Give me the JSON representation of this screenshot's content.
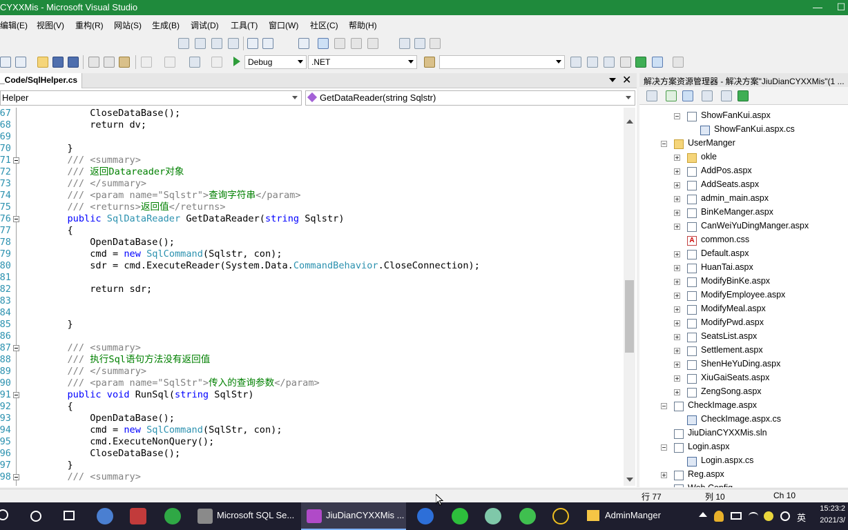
{
  "window": {
    "title": "CYXXMis - Microsoft Visual Studio",
    "minimize": "—",
    "maximize": "☐"
  },
  "menu": [
    "编辑(E)",
    "视图(V)",
    "重构(R)",
    "网站(S)",
    "生成(B)",
    "调试(D)",
    "工具(T)",
    "窗口(W)",
    "社区(C)",
    "帮助(H)"
  ],
  "toolbar": {
    "config": "Debug",
    "platform": ".NET"
  },
  "editor": {
    "tab": "_Code/SqlHelper.cs",
    "class_combo": "Helper",
    "member_combo": "GetDataReader(string Sqlstr)",
    "lines": [
      {
        "n": "67",
        "text": "            CloseDataBase();",
        "kind": "plain"
      },
      {
        "n": "68",
        "text": "            return dv;",
        "kind": "plain"
      },
      {
        "n": "69",
        "text": "",
        "kind": "plain"
      },
      {
        "n": "70",
        "text": "        }",
        "kind": "plain"
      },
      {
        "n": "71",
        "text": "        /// <summary>",
        "kind": "doc",
        "fold": true
      },
      {
        "n": "72",
        "text": "        /// 返回Datareader对象",
        "kind": "doc"
      },
      {
        "n": "73",
        "text": "        /// </summary>",
        "kind": "doc"
      },
      {
        "n": "74",
        "text": "        /// <param name=\"Sqlstr\">查询字符串</param>",
        "kind": "doc"
      },
      {
        "n": "75",
        "text": "        /// <returns>返回值</returns>",
        "kind": "doc"
      },
      {
        "n": "76",
        "text": "        public SqlDataReader GetDataReader(string Sqlstr)",
        "kind": "code",
        "fold": true
      },
      {
        "n": "77",
        "text": "        {",
        "kind": "plain"
      },
      {
        "n": "78",
        "text": "            OpenDataBase();",
        "kind": "plain"
      },
      {
        "n": "79",
        "text": "            cmd = new SqlCommand(Sqlstr, con);",
        "kind": "code"
      },
      {
        "n": "80",
        "text": "            sdr = cmd.ExecuteReader(System.Data.CommandBehavior.CloseConnection);",
        "kind": "code"
      },
      {
        "n": "81",
        "text": "",
        "kind": "plain"
      },
      {
        "n": "82",
        "text": "            return sdr;",
        "kind": "plain"
      },
      {
        "n": "83",
        "text": "",
        "kind": "plain"
      },
      {
        "n": "84",
        "text": "",
        "kind": "plain"
      },
      {
        "n": "85",
        "text": "        }",
        "kind": "plain"
      },
      {
        "n": "86",
        "text": "",
        "kind": "plain"
      },
      {
        "n": "87",
        "text": "        /// <summary>",
        "kind": "doc",
        "fold": true
      },
      {
        "n": "88",
        "text": "        /// 执行Sql语句方法没有返回值",
        "kind": "doc"
      },
      {
        "n": "89",
        "text": "        /// </summary>",
        "kind": "doc"
      },
      {
        "n": "90",
        "text": "        /// <param name=\"SqlStr\">传入的查询参数</param>",
        "kind": "doc"
      },
      {
        "n": "91",
        "text": "        public void RunSql(string SqlStr)",
        "kind": "code",
        "fold": true
      },
      {
        "n": "92",
        "text": "        {",
        "kind": "plain"
      },
      {
        "n": "93",
        "text": "            OpenDataBase();",
        "kind": "plain"
      },
      {
        "n": "94",
        "text": "            cmd = new SqlCommand(SqlStr, con);",
        "kind": "code"
      },
      {
        "n": "95",
        "text": "            cmd.ExecuteNonQuery();",
        "kind": "plain"
      },
      {
        "n": "96",
        "text": "            CloseDataBase();",
        "kind": "plain"
      },
      {
        "n": "97",
        "text": "        }",
        "kind": "plain"
      },
      {
        "n": "98",
        "text": "        /// <summary>",
        "kind": "doc",
        "fold": true
      }
    ]
  },
  "solution_explorer": {
    "title": "解决方案资源管理器 - 解决方案\"JiuDianCYXXMis\"(1 ...",
    "items": [
      {
        "label": "ShowFanKui.aspx",
        "indent": 1,
        "icon": "page",
        "exp": "minus"
      },
      {
        "label": "ShowFanKui.aspx.cs",
        "indent": 2,
        "icon": "cs",
        "exp": ""
      },
      {
        "label": "UserManger",
        "indent": 0,
        "icon": "folder",
        "exp": "minus"
      },
      {
        "label": "okle",
        "indent": 1,
        "icon": "folder",
        "exp": "plus"
      },
      {
        "label": "AddPos.aspx",
        "indent": 1,
        "icon": "page",
        "exp": "plus"
      },
      {
        "label": "AddSeats.aspx",
        "indent": 1,
        "icon": "page",
        "exp": "plus"
      },
      {
        "label": "admin_main.aspx",
        "indent": 1,
        "icon": "page",
        "exp": "plus"
      },
      {
        "label": "BinKeManger.aspx",
        "indent": 1,
        "icon": "page",
        "exp": "plus"
      },
      {
        "label": "CanWeiYuDingManger.aspx",
        "indent": 1,
        "icon": "page",
        "exp": "plus"
      },
      {
        "label": "common.css",
        "indent": 1,
        "icon": "css",
        "exp": ""
      },
      {
        "label": "Default.aspx",
        "indent": 1,
        "icon": "page",
        "exp": "plus"
      },
      {
        "label": "HuanTai.aspx",
        "indent": 1,
        "icon": "page",
        "exp": "plus"
      },
      {
        "label": "ModifyBinKe.aspx",
        "indent": 1,
        "icon": "page",
        "exp": "plus"
      },
      {
        "label": "ModifyEmployee.aspx",
        "indent": 1,
        "icon": "page",
        "exp": "plus"
      },
      {
        "label": "ModifyMeal.aspx",
        "indent": 1,
        "icon": "page",
        "exp": "plus"
      },
      {
        "label": "ModifyPwd.aspx",
        "indent": 1,
        "icon": "page",
        "exp": "plus"
      },
      {
        "label": "SeatsList.aspx",
        "indent": 1,
        "icon": "page",
        "exp": "plus"
      },
      {
        "label": "Settlement.aspx",
        "indent": 1,
        "icon": "page",
        "exp": "plus"
      },
      {
        "label": "ShenHeYuDing.aspx",
        "indent": 1,
        "icon": "page",
        "exp": "plus"
      },
      {
        "label": "XiuGaiSeats.aspx",
        "indent": 1,
        "icon": "page",
        "exp": "plus"
      },
      {
        "label": "ZengSong.aspx",
        "indent": 1,
        "icon": "page",
        "exp": "plus"
      },
      {
        "label": "CheckImage.aspx",
        "indent": 0,
        "icon": "page",
        "exp": "minus"
      },
      {
        "label": "CheckImage.aspx.cs",
        "indent": 1,
        "icon": "cs",
        "exp": ""
      },
      {
        "label": "JiuDianCYXXMis.sln",
        "indent": 0,
        "icon": "page",
        "exp": ""
      },
      {
        "label": "Login.aspx",
        "indent": 0,
        "icon": "page",
        "exp": "minus"
      },
      {
        "label": "Login.aspx.cs",
        "indent": 1,
        "icon": "cs",
        "exp": ""
      },
      {
        "label": "Reg.aspx",
        "indent": 0,
        "icon": "page",
        "exp": "plus"
      },
      {
        "label": "Web.Config",
        "indent": 0,
        "icon": "page",
        "exp": ""
      }
    ]
  },
  "status": {
    "line": "行 77",
    "col": "列 10",
    "ch": "Ch 10"
  },
  "taskbar": {
    "sql": "Microsoft SQL Se...",
    "vs": "JiuDianCYXXMis ...",
    "folder": "AdminManger",
    "ime": "英",
    "time": "15:23:2",
    "date": "2021/3/"
  },
  "colors": {
    "titlebar": "#1f8a3c",
    "keyword": "#0000ff",
    "type": "#2b91af",
    "comment": "#008000"
  }
}
